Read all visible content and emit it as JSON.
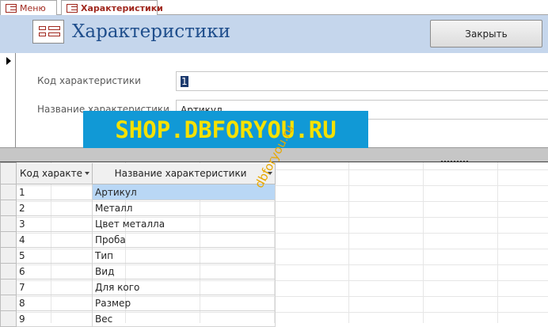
{
  "tabs": [
    {
      "label": "Меню"
    },
    {
      "label": "Характеристики"
    }
  ],
  "header": {
    "title": "Характеристики",
    "close_label": "Закрыть"
  },
  "form": {
    "code_label": "Код характеристики",
    "code_value": "1",
    "name_label": "Название характеристики",
    "name_value": "Артикул"
  },
  "watermark": {
    "banner": "SHOP.DBFORYOU.RU",
    "diagonal": "dbforyou.ru"
  },
  "datasheet": {
    "columns": [
      "Код характе",
      "Название характеристики"
    ],
    "rows": [
      {
        "code": "1",
        "name": "Артикул"
      },
      {
        "code": "2",
        "name": "Металл"
      },
      {
        "code": "3",
        "name": "Цвет металла"
      },
      {
        "code": "4",
        "name": "Проба"
      },
      {
        "code": "5",
        "name": "Тип"
      },
      {
        "code": "6",
        "name": "Вид"
      },
      {
        "code": "7",
        "name": "Для кого"
      },
      {
        "code": "8",
        "name": "Размер"
      },
      {
        "code": "9",
        "name": "Вес"
      }
    ]
  },
  "colors": {
    "accent": "#a0281e",
    "header_bg": "#c5d6ec",
    "title": "#1f4e8c",
    "selection": "#b9d7f5",
    "watermark_bg": "#1199d6",
    "watermark_fg": "#f5e100"
  }
}
